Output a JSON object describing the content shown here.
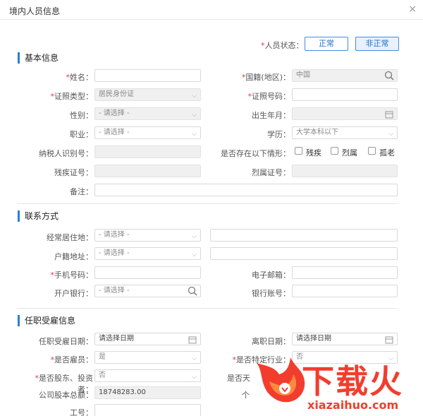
{
  "window": {
    "title": "境内人员信息",
    "close": "×"
  },
  "status": {
    "label": "人员状态：",
    "normal": "正常",
    "abnormal": "非正常"
  },
  "sections": {
    "basic": "基本信息",
    "contact": "联系方式",
    "employment": "任职受雇信息"
  },
  "basic": {
    "name_label": "姓名：",
    "nationality_label": "国籍(地区)：",
    "nationality_value": "中国",
    "id_type_label": "证照类型：",
    "id_type_value": "居民身份证",
    "id_number_label": "证照号码：",
    "gender_label": "性别：",
    "gender_value": "- 请选择 -",
    "birth_label": "出生年月：",
    "occupation_label": "职业：",
    "occupation_value": "- 请选择 -",
    "education_label": "学历：",
    "education_value": "大学本科以下",
    "taxpayer_label": "纳税人识别号：",
    "situation_label": "是否存在以下情形：",
    "disabled": "残疾",
    "martyr": "烈属",
    "elderly": "孤老",
    "disabled_cert_label": "残疾证号：",
    "martyr_cert_label": "烈属证号：",
    "remark_label": "备注："
  },
  "contact": {
    "residence_label": "经常居住地：",
    "residence_value": "- 请选择 -",
    "household_label": "户籍地址：",
    "household_value": "- 请选择 -",
    "phone_label": "手机号码：",
    "email_label": "电子邮箱：",
    "bank_label": "开户银行：",
    "bank_value": "- 请选择 -",
    "account_label": "银行账号："
  },
  "employment": {
    "hire_date_label": "任职受雇日期：",
    "hire_date_value": "请选择日期",
    "leave_date_label": "离职日期：",
    "leave_date_value": "请选择日期",
    "employee_label": "是否雇员：",
    "employee_value": "是",
    "special_label": "是否特定行业：",
    "special_value": "否",
    "shareholder_label": "是否股东、投资者：",
    "shareholder_value": "否",
    "partial_label": "是否天",
    "capital_label": "公司股本总额：",
    "capital_value": "18748283.00",
    "partial_unit": "个",
    "job_no_label": "工号："
  },
  "watermark": {
    "brand": "下载火",
    "url": "xiazaihuo.com"
  },
  "colors": {
    "accent": "#2a7fd6",
    "required": "#e4393c",
    "brand": "#f23d2e"
  }
}
